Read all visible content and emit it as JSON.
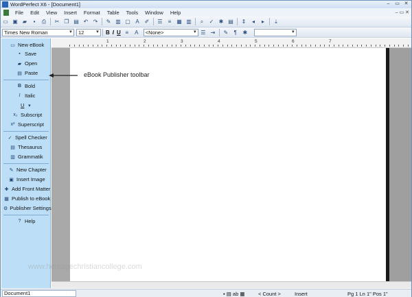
{
  "window": {
    "title": "WordPerfect X6 - [Document1]",
    "controls": [
      "–",
      "▭",
      "✕"
    ]
  },
  "menu": {
    "items": [
      "File",
      "Edit",
      "View",
      "Insert",
      "Format",
      "Table",
      "Tools",
      "Window",
      "Help"
    ],
    "doc_controls": "– ▭ ✕"
  },
  "format_bar": {
    "font": "Times New Roman",
    "size": "12",
    "style": "<None>",
    "bold": "B",
    "italic": "I",
    "underline": "U"
  },
  "ebook_toolbar": {
    "items": [
      {
        "icon": "new-ebook-icon",
        "label": "New eBook"
      },
      {
        "icon": "save-icon",
        "label": "Save"
      },
      {
        "icon": "open-icon",
        "label": "Open"
      },
      {
        "icon": "paste-icon",
        "label": "Paste"
      },
      {
        "icon": "bold-icon",
        "label": "Bold"
      },
      {
        "icon": "italic-icon",
        "label": "Italic"
      },
      {
        "icon": "underline-icon",
        "label": "U"
      },
      {
        "icon": "subscript-icon",
        "label": "Subscript"
      },
      {
        "icon": "superscript-icon",
        "label": "Superscript"
      },
      {
        "icon": "spell-checker-icon",
        "label": "Spell Checker"
      },
      {
        "icon": "thesaurus-icon",
        "label": "Thesaurus"
      },
      {
        "icon": "grammatik-icon",
        "label": "Grammatik"
      },
      {
        "icon": "new-chapter-icon",
        "label": "New Chapter"
      },
      {
        "icon": "insert-image-icon",
        "label": "Insert Image"
      },
      {
        "icon": "add-front-matter-icon",
        "label": "Add Front Matter"
      },
      {
        "icon": "publish-icon",
        "label": "Publish to eBook"
      },
      {
        "icon": "publisher-settings-icon",
        "label": "Publisher Settings"
      },
      {
        "icon": "help-icon",
        "label": "Help"
      }
    ]
  },
  "ruler": {
    "numbers": [
      "1",
      "2",
      "3",
      "4",
      "5",
      "6",
      "7"
    ]
  },
  "annotation": {
    "text": "eBook Publisher toolbar"
  },
  "statusbar": {
    "document": "Document1",
    "count": "< Count >",
    "mode": "Insert",
    "position": "Pg 1 Ln 1\" Pos 1\""
  },
  "watermark": "www.heritagechristiancollege.com"
}
